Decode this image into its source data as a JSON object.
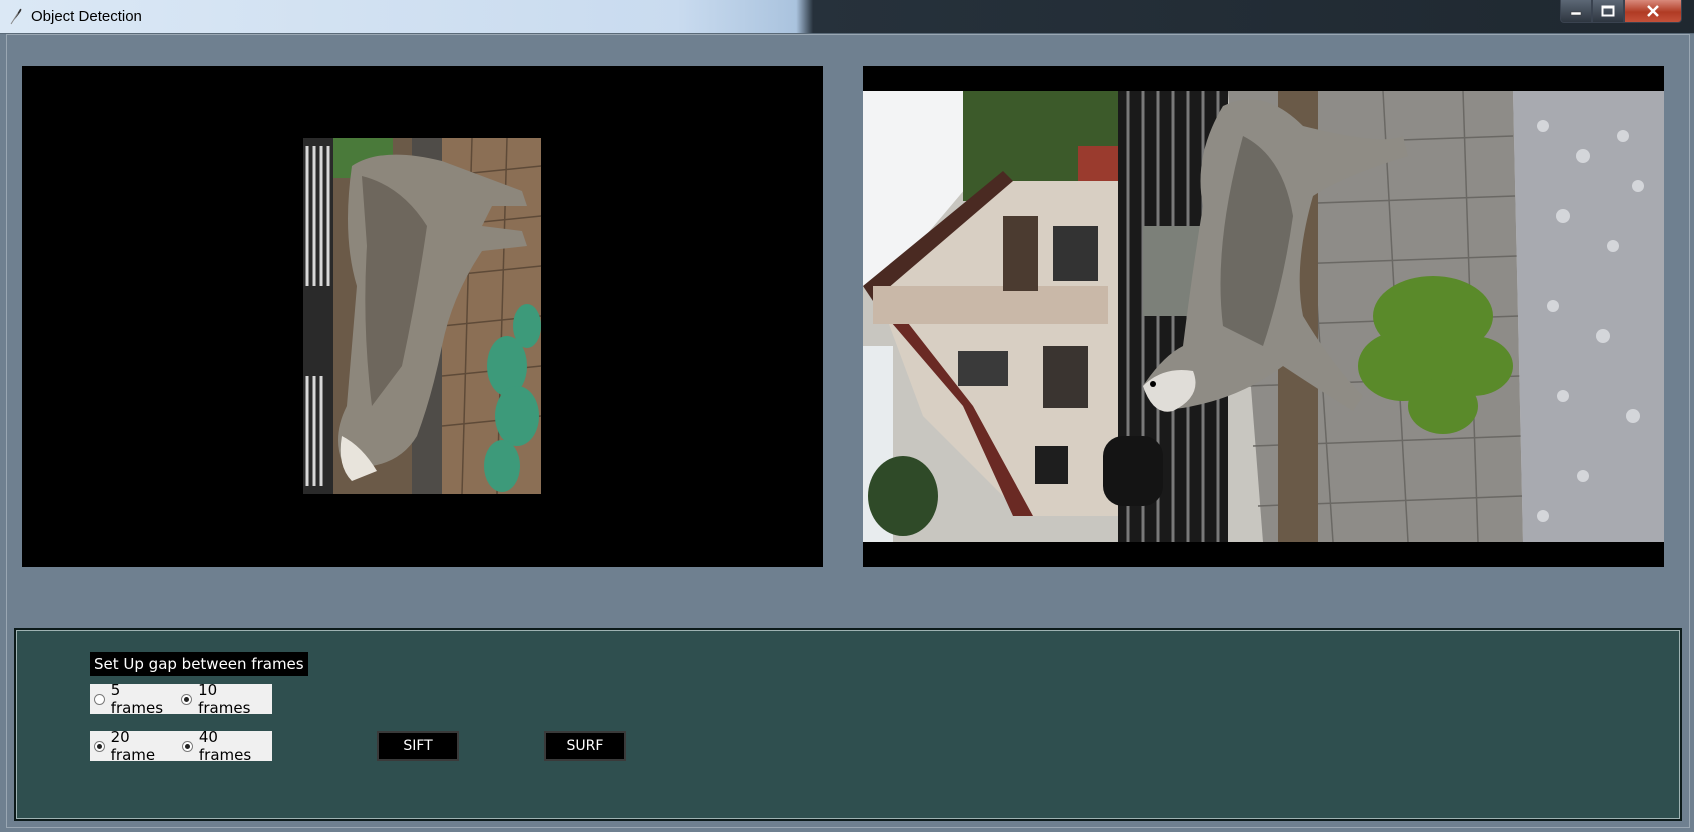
{
  "window": {
    "title": "Object Detection",
    "icon": "feather-icon"
  },
  "panels": {
    "left_view": {
      "content": "rotated frame of husky dog on patio",
      "icon": "image-frame"
    },
    "right_view": {
      "content": "rotated frame of husky dog beside house",
      "icon": "image-frame"
    }
  },
  "controls": {
    "gap_label": "Set Up gap between frames",
    "options_row1": [
      {
        "label": "5 frames",
        "checked": false
      },
      {
        "label": "10 frames",
        "checked": true
      }
    ],
    "options_row2": [
      {
        "label": "20 frame",
        "checked": true
      },
      {
        "label": "40 frames",
        "checked": true
      }
    ],
    "sift_label": "SIFT",
    "surf_label": "SURF"
  },
  "colors": {
    "background": "#6f8090",
    "control_panel": "#2f4f4f",
    "video_bg": "#000000"
  }
}
